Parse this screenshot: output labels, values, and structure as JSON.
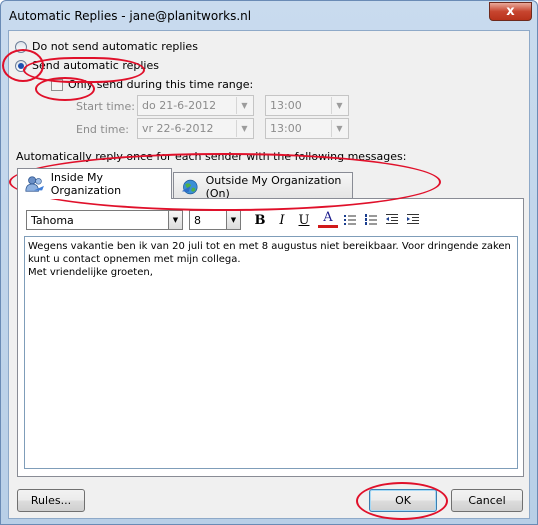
{
  "window": {
    "title": "Automatic Replies - jane@planitworks.nl",
    "close_label": "x"
  },
  "options": {
    "do_not_send": "Do not send automatic replies",
    "send": "Send automatic replies",
    "time_range": "Only send during this time range:"
  },
  "time": {
    "start_label": "Start time:",
    "start_date": "do 21-6-2012",
    "start_hour": "13:00",
    "end_label": "End time:",
    "end_date": "vr 22-6-2012",
    "end_hour": "13:00"
  },
  "section_label": "Automatically reply once for each sender with the following messages:",
  "tabs": [
    {
      "label": "Inside My Organization",
      "icon": "people-icon",
      "active": true
    },
    {
      "label": "Outside My Organization (On)",
      "icon": "globe-icon",
      "active": false
    }
  ],
  "toolbar": {
    "font_name": "Tahoma",
    "font_size": "8",
    "bold": "B",
    "italic": "I",
    "underline": "U",
    "font_color": "A"
  },
  "message": {
    "line1": "Wegens vakantie ben ik van 20 juli tot en met 8 augustus niet bereikbaar. Voor dringende zaken",
    "line2": "kunt u contact opnemen met mijn collega.",
    "line3": "",
    "line4": "Met vriendelijke groeten,"
  },
  "buttons": {
    "rules": "Rules...",
    "ok": "OK",
    "cancel": "Cancel"
  },
  "colors": {
    "annotation": "#e0102a",
    "title_bar": "#c9dbee",
    "close_button": "#c7452f"
  }
}
